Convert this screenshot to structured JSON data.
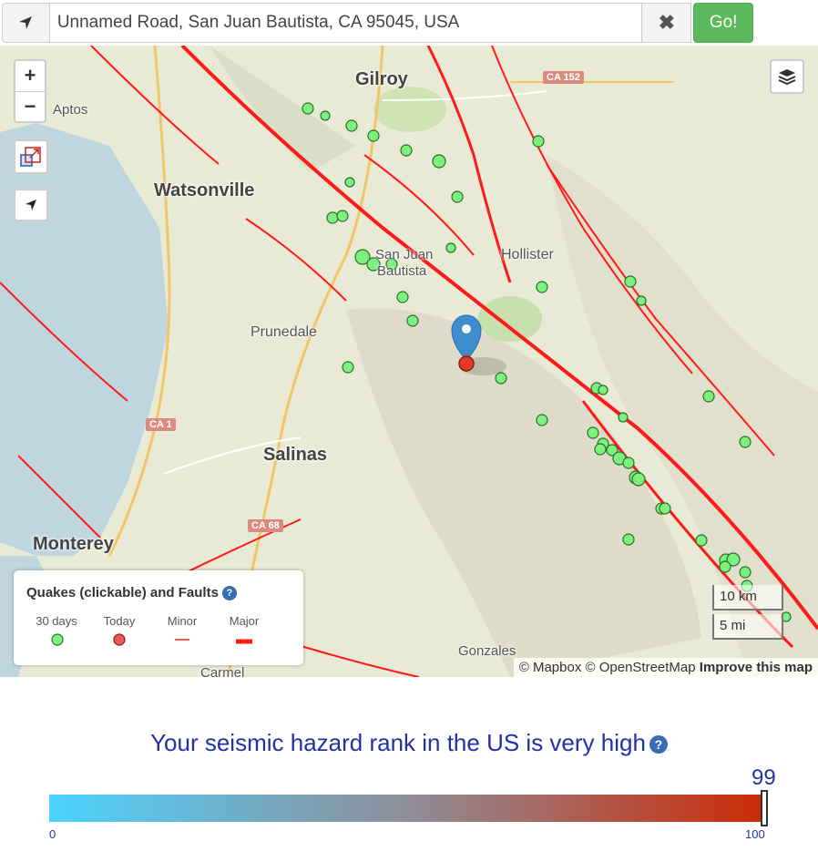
{
  "search": {
    "address": "Unnamed Road, San Juan Bautista, CA 95045, USA",
    "clear_label": "✖",
    "go_label": "Go!"
  },
  "map": {
    "zoom_in": "+",
    "zoom_out": "−",
    "places": {
      "gilroy": "Gilroy",
      "aptos": "Aptos",
      "watsonville": "Watsonville",
      "san_juan": "San Juan",
      "bautista": "Bautista",
      "hollister": "Hollister",
      "prunedale": "Prunedale",
      "salinas": "Salinas",
      "monterey": "Monterey",
      "gonzales": "Gonzales",
      "carmel": "Carmel"
    },
    "shields": {
      "ca152": "CA 152",
      "ca1": "CA 1",
      "ca68": "CA 68"
    },
    "scale_km": "10 km",
    "scale_mi": "5 mi",
    "attribution_prefix": "© Mapbox © OpenStreetMap",
    "attribution_link": "Improve this map",
    "colors": {
      "fault": "#ff1a1a",
      "quake_30d": "#7ef07e",
      "quake_today": "#e85a5a",
      "marker": "#3f8ccf"
    }
  },
  "legend": {
    "title": "Quakes (clickable) and Faults",
    "help": "?",
    "items": [
      "30 days",
      "Today",
      "Minor",
      "Major"
    ]
  },
  "hazard": {
    "text": "Your seismic hazard rank in the US is very high",
    "help": "?",
    "rank": "99",
    "min": "0",
    "max": "100",
    "rank_fraction": 0.99
  }
}
